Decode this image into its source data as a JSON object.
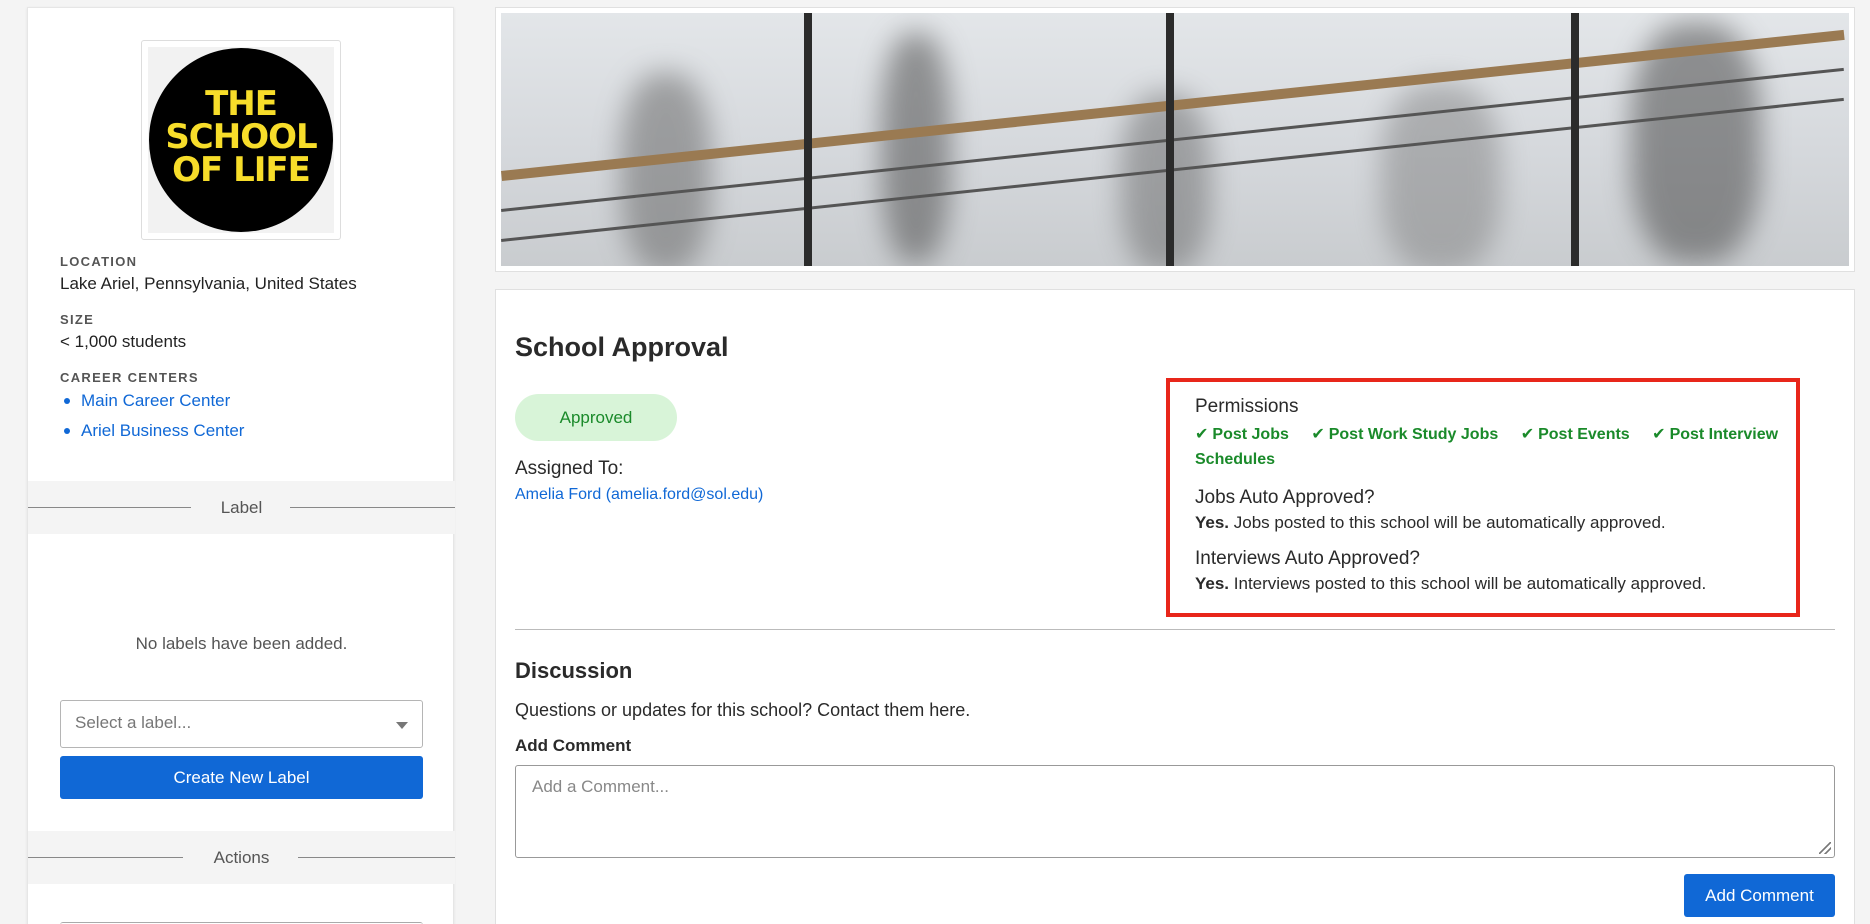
{
  "sidebar": {
    "logo_text": "THE\nSCHOOL\nOF LIFE",
    "location_label": "LOCATION",
    "location_value": "Lake Ariel, Pennsylvania, United States",
    "size_label": "SIZE",
    "size_value": "< 1,000 students",
    "career_centers_label": "CAREER CENTERS",
    "career_centers": [
      {
        "label": "Main Career Center"
      },
      {
        "label": "Ariel Business Center"
      }
    ],
    "label_section_title": "Label",
    "empty_labels": "No labels have been added.",
    "select_placeholder": "Select a label...",
    "create_label_button": "Create New Label",
    "actions_section_title": "Actions"
  },
  "approval": {
    "title": "School Approval",
    "status": "Approved",
    "assigned_label": "Assigned To:",
    "assigned_value": "Amelia Ford (amelia.ford@sol.edu)",
    "permissions_heading": "Permissions",
    "permissions": [
      {
        "label": "Post Jobs"
      },
      {
        "label": "Post Work Study Jobs"
      },
      {
        "label": "Post Events"
      },
      {
        "label": "Post Interview Schedules"
      }
    ],
    "jobs_auto_question": "Jobs Auto Approved?",
    "jobs_auto_answer_strong": "Yes.",
    "jobs_auto_answer_text": " Jobs posted to this school will be automatically approved.",
    "interviews_auto_question": "Interviews Auto Approved?",
    "interviews_auto_answer_strong": "Yes.",
    "interviews_auto_answer_text": " Interviews posted to this school will be automatically approved."
  },
  "discussion": {
    "title": "Discussion",
    "subtitle": "Questions or updates for this school? Contact them here.",
    "add_comment_label": "Add Comment",
    "comment_placeholder": "Add a Comment...",
    "add_comment_button": "Add Comment"
  },
  "colors": {
    "accent": "#1068d6",
    "success_text": "#1a8a2a",
    "success_bg": "#d8f4d8",
    "highlight_border": "#e8261a"
  },
  "icons": {
    "permission_check": "check-icon",
    "select_caret": "chevron-down-icon"
  }
}
